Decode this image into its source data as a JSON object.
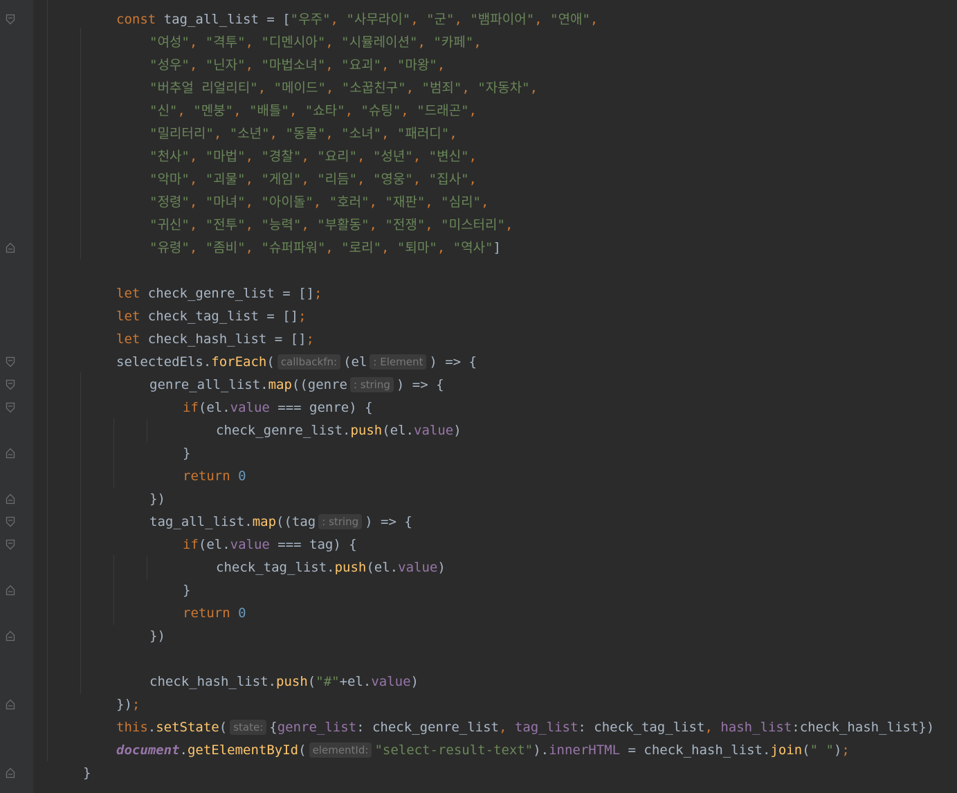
{
  "code_lines": [
    [
      [
        "const",
        "kw"
      ],
      [
        " tag_all_list = [",
        "txt"
      ],
      [
        "\"우주\"",
        "str"
      ],
      [
        ", ",
        "kw"
      ],
      [
        "\"사무라이\"",
        "str"
      ],
      [
        ", ",
        "kw"
      ],
      [
        "\"군\"",
        "str"
      ],
      [
        ", ",
        "kw"
      ],
      [
        "\"뱀파이어\"",
        "str"
      ],
      [
        ", ",
        "kw"
      ],
      [
        "\"연애\"",
        "str"
      ],
      [
        ",",
        "kw"
      ]
    ],
    [
      [
        "\"여성\"",
        "str"
      ],
      [
        ", ",
        "kw"
      ],
      [
        "\"격투\"",
        "str"
      ],
      [
        ", ",
        "kw"
      ],
      [
        "\"디멘시아\"",
        "str"
      ],
      [
        ", ",
        "kw"
      ],
      [
        "\"시뮬레이션\"",
        "str"
      ],
      [
        ", ",
        "kw"
      ],
      [
        "\"카페\"",
        "str"
      ],
      [
        ",",
        "kw"
      ]
    ],
    [
      [
        "\"성우\"",
        "str"
      ],
      [
        ", ",
        "kw"
      ],
      [
        "\"닌자\"",
        "str"
      ],
      [
        ", ",
        "kw"
      ],
      [
        "\"마법소녀\"",
        "str"
      ],
      [
        ", ",
        "kw"
      ],
      [
        "\"요괴\"",
        "str"
      ],
      [
        ", ",
        "kw"
      ],
      [
        "\"마왕\"",
        "str"
      ],
      [
        ",",
        "kw"
      ]
    ],
    [
      [
        "\"버추얼 리얼리티\"",
        "str"
      ],
      [
        ", ",
        "kw"
      ],
      [
        "\"메이드\"",
        "str"
      ],
      [
        ", ",
        "kw"
      ],
      [
        "\"소꿉친구\"",
        "str"
      ],
      [
        ", ",
        "kw"
      ],
      [
        "\"범죄\"",
        "str"
      ],
      [
        ", ",
        "kw"
      ],
      [
        "\"자동차\"",
        "str"
      ],
      [
        ",",
        "kw"
      ]
    ],
    [
      [
        "\"신\"",
        "str"
      ],
      [
        ", ",
        "kw"
      ],
      [
        "\"멘붕\"",
        "str"
      ],
      [
        ", ",
        "kw"
      ],
      [
        "\"배틀\"",
        "str"
      ],
      [
        ", ",
        "kw"
      ],
      [
        "\"쇼타\"",
        "str"
      ],
      [
        ", ",
        "kw"
      ],
      [
        "\"슈팅\"",
        "str"
      ],
      [
        ", ",
        "kw"
      ],
      [
        "\"드래곤\"",
        "str"
      ],
      [
        ",",
        "kw"
      ]
    ],
    [
      [
        "\"밀리터리\"",
        "str"
      ],
      [
        ", ",
        "kw"
      ],
      [
        "\"소년\"",
        "str"
      ],
      [
        ", ",
        "kw"
      ],
      [
        "\"동물\"",
        "str"
      ],
      [
        ", ",
        "kw"
      ],
      [
        "\"소녀\"",
        "str"
      ],
      [
        ", ",
        "kw"
      ],
      [
        "\"패러디\"",
        "str"
      ],
      [
        ",",
        "kw"
      ]
    ],
    [
      [
        "\"천사\"",
        "str"
      ],
      [
        ", ",
        "kw"
      ],
      [
        "\"마법\"",
        "str"
      ],
      [
        ", ",
        "kw"
      ],
      [
        "\"경찰\"",
        "str"
      ],
      [
        ", ",
        "kw"
      ],
      [
        "\"요리\"",
        "str"
      ],
      [
        ", ",
        "kw"
      ],
      [
        "\"성년\"",
        "str"
      ],
      [
        ", ",
        "kw"
      ],
      [
        "\"변신\"",
        "str"
      ],
      [
        ",",
        "kw"
      ]
    ],
    [
      [
        "\"악마\"",
        "str"
      ],
      [
        ", ",
        "kw"
      ],
      [
        "\"괴물\"",
        "str"
      ],
      [
        ", ",
        "kw"
      ],
      [
        "\"게임\"",
        "str"
      ],
      [
        ", ",
        "kw"
      ],
      [
        "\"리듬\"",
        "str"
      ],
      [
        ", ",
        "kw"
      ],
      [
        "\"영웅\"",
        "str"
      ],
      [
        ", ",
        "kw"
      ],
      [
        "\"집사\"",
        "str"
      ],
      [
        ",",
        "kw"
      ]
    ],
    [
      [
        "\"정령\"",
        "str"
      ],
      [
        ", ",
        "kw"
      ],
      [
        "\"마녀\"",
        "str"
      ],
      [
        ", ",
        "kw"
      ],
      [
        "\"아이돌\"",
        "str"
      ],
      [
        ", ",
        "kw"
      ],
      [
        "\"호러\"",
        "str"
      ],
      [
        ", ",
        "kw"
      ],
      [
        "\"재판\"",
        "str"
      ],
      [
        ", ",
        "kw"
      ],
      [
        "\"심리\"",
        "str"
      ],
      [
        ",",
        "kw"
      ]
    ],
    [
      [
        "\"귀신\"",
        "str"
      ],
      [
        ", ",
        "kw"
      ],
      [
        "\"전투\"",
        "str"
      ],
      [
        ", ",
        "kw"
      ],
      [
        "\"능력\"",
        "str"
      ],
      [
        ", ",
        "kw"
      ],
      [
        "\"부활동\"",
        "str"
      ],
      [
        ", ",
        "kw"
      ],
      [
        "\"전쟁\"",
        "str"
      ],
      [
        ", ",
        "kw"
      ],
      [
        "\"미스터리\"",
        "str"
      ],
      [
        ",",
        "kw"
      ]
    ],
    [
      [
        "\"유령\"",
        "str"
      ],
      [
        ", ",
        "kw"
      ],
      [
        "\"좀비\"",
        "str"
      ],
      [
        ", ",
        "kw"
      ],
      [
        "\"슈퍼파워\"",
        "str"
      ],
      [
        ", ",
        "kw"
      ],
      [
        "\"로리\"",
        "str"
      ],
      [
        ", ",
        "kw"
      ],
      [
        "\"퇴마\"",
        "str"
      ],
      [
        ", ",
        "kw"
      ],
      [
        "\"역사\"",
        "str"
      ],
      [
        "]",
        "txt"
      ]
    ],
    [],
    [
      [
        "let",
        "kw"
      ],
      [
        " check_genre_list = []",
        "txt"
      ],
      [
        ";",
        "kw"
      ]
    ],
    [
      [
        "let",
        "kw"
      ],
      [
        " check_tag_list = []",
        "txt"
      ],
      [
        ";",
        "kw"
      ]
    ],
    [
      [
        "let",
        "kw"
      ],
      [
        " check_hash_list = []",
        "txt"
      ],
      [
        ";",
        "kw"
      ]
    ],
    [
      [
        "selectedEls.",
        "txt"
      ],
      [
        "forEach",
        "fn"
      ],
      [
        "(",
        "txt"
      ],
      [
        "callbackfn:",
        "hint"
      ],
      [
        "(el",
        "txt"
      ],
      [
        ": Element",
        "hint"
      ],
      [
        ") => {",
        "txt"
      ]
    ],
    [
      [
        "genre_all_list.",
        "txt"
      ],
      [
        "map",
        "fn"
      ],
      [
        "((genre",
        "txt"
      ],
      [
        ": string",
        "hint"
      ],
      [
        ") => {",
        "txt"
      ]
    ],
    [
      [
        "if",
        "kw"
      ],
      [
        "(el.",
        "txt"
      ],
      [
        "value",
        "prop"
      ],
      [
        " === genre) {",
        "txt"
      ]
    ],
    [
      [
        "check_genre_list.",
        "txt"
      ],
      [
        "push",
        "fn"
      ],
      [
        "(el.",
        "txt"
      ],
      [
        "value",
        "prop"
      ],
      [
        ")",
        "txt"
      ]
    ],
    [
      [
        "}",
        "txt"
      ]
    ],
    [
      [
        "return ",
        "kw"
      ],
      [
        "0",
        "num"
      ]
    ],
    [
      [
        "})",
        "txt"
      ]
    ],
    [
      [
        "tag_all_list.",
        "txt"
      ],
      [
        "map",
        "fn"
      ],
      [
        "((tag",
        "txt"
      ],
      [
        ": string",
        "hint"
      ],
      [
        ") => {",
        "txt"
      ]
    ],
    [
      [
        "if",
        "kw"
      ],
      [
        "(el.",
        "txt"
      ],
      [
        "value",
        "prop"
      ],
      [
        " === tag) {",
        "txt"
      ]
    ],
    [
      [
        "check_tag_list.",
        "txt"
      ],
      [
        "push",
        "fn"
      ],
      [
        "(el.",
        "txt"
      ],
      [
        "value",
        "prop"
      ],
      [
        ")",
        "txt"
      ]
    ],
    [
      [
        "}",
        "txt"
      ]
    ],
    [
      [
        "return ",
        "kw"
      ],
      [
        "0",
        "num"
      ]
    ],
    [
      [
        "})",
        "txt"
      ]
    ],
    [],
    [
      [
        "check_hash_list.",
        "txt"
      ],
      [
        "push",
        "fn"
      ],
      [
        "(",
        "txt"
      ],
      [
        "\"#\"",
        "str"
      ],
      [
        "+el.",
        "txt"
      ],
      [
        "value",
        "prop"
      ],
      [
        ")",
        "txt"
      ]
    ],
    [
      [
        "})",
        "txt"
      ],
      [
        ";",
        "kw"
      ]
    ],
    [
      [
        "this",
        "kw"
      ],
      [
        ".",
        "txt"
      ],
      [
        "setState",
        "fn"
      ],
      [
        "(",
        "txt"
      ],
      [
        "state:",
        "hint"
      ],
      [
        "{",
        "txt"
      ],
      [
        "genre_list",
        "prop"
      ],
      [
        ": check_genre_list",
        "txt"
      ],
      [
        ", ",
        "kw"
      ],
      [
        "tag_list",
        "prop"
      ],
      [
        ": check_tag_list",
        "txt"
      ],
      [
        ", ",
        "kw"
      ],
      [
        "hash_list",
        "prop"
      ],
      [
        ":check_hash_list})",
        "txt"
      ]
    ],
    [
      [
        "document",
        "glob"
      ],
      [
        ".",
        "txt"
      ],
      [
        "getElementById",
        "fn"
      ],
      [
        "(",
        "txt"
      ],
      [
        "elementId:",
        "hint"
      ],
      [
        "\"select-result-text\"",
        "str"
      ],
      [
        ").",
        "txt"
      ],
      [
        "innerHTML",
        "prop"
      ],
      [
        " = check_hash_list.",
        "txt"
      ],
      [
        "join",
        "fn"
      ],
      [
        "(",
        "txt"
      ],
      [
        "\" \"",
        "str"
      ],
      [
        ")",
        "txt"
      ],
      [
        ";",
        "kw"
      ]
    ],
    [
      [
        "}",
        "txt"
      ]
    ]
  ],
  "fold_markers": [
    {
      "line": 0,
      "kind": "fold-open-icon"
    },
    {
      "line": 10,
      "kind": "fold-close-icon"
    },
    {
      "line": 15,
      "kind": "fold-open-icon"
    },
    {
      "line": 16,
      "kind": "fold-open-icon"
    },
    {
      "line": 17,
      "kind": "fold-open-icon"
    },
    {
      "line": 19,
      "kind": "fold-close-icon"
    },
    {
      "line": 21,
      "kind": "fold-close-icon"
    },
    {
      "line": 22,
      "kind": "fold-open-icon"
    },
    {
      "line": 23,
      "kind": "fold-open-icon"
    },
    {
      "line": 25,
      "kind": "fold-close-icon"
    },
    {
      "line": 27,
      "kind": "fold-close-icon"
    },
    {
      "line": 30,
      "kind": "fold-close-icon"
    },
    {
      "line": 33,
      "kind": "fold-close-icon"
    }
  ],
  "indent_levels": [
    2,
    3,
    3,
    3,
    3,
    3,
    3,
    3,
    3,
    3,
    3,
    0,
    2,
    2,
    2,
    2,
    3,
    4,
    5,
    4,
    4,
    3,
    3,
    4,
    5,
    4,
    4,
    3,
    0,
    3,
    2,
    2,
    2,
    1
  ]
}
